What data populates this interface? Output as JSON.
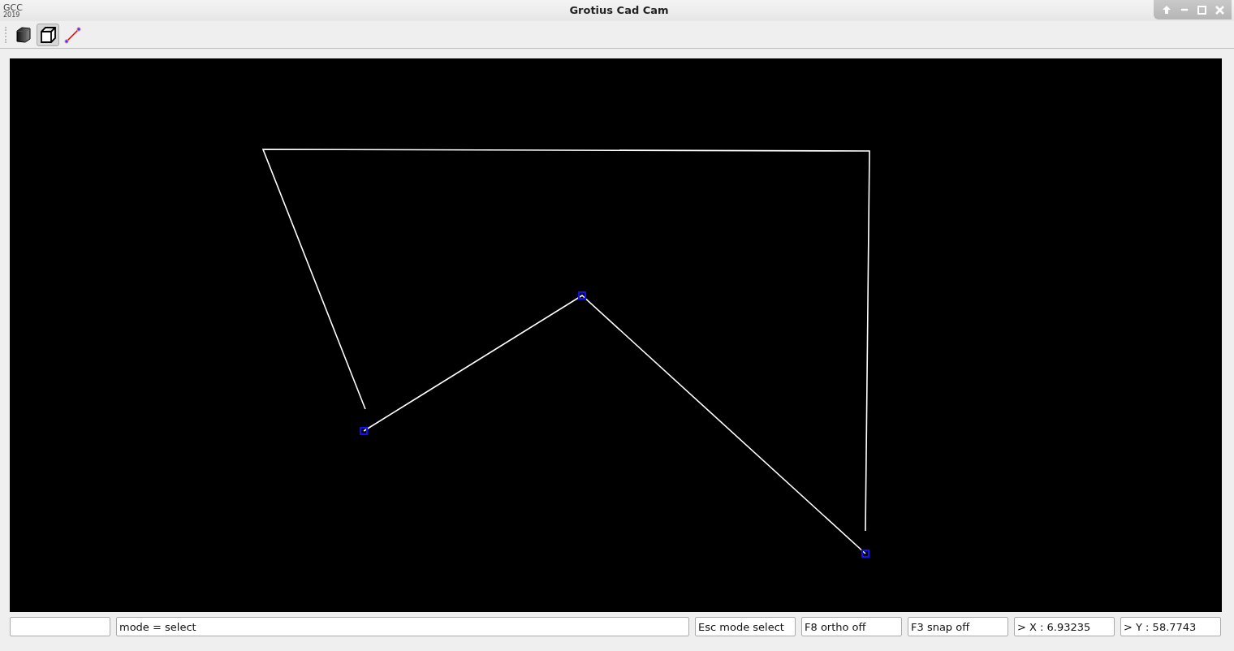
{
  "window": {
    "title": "Grotius Cad Cam",
    "logo": {
      "name": "GCC",
      "year": "2019"
    }
  },
  "toolbar": [
    {
      "kind": "solid-cube",
      "selected": false
    },
    {
      "kind": "wireframe-cube",
      "selected": true
    },
    {
      "kind": "line",
      "selected": false
    }
  ],
  "status_fields": [
    {
      "kind": "blank"
    },
    {
      "kind": "text",
      "value": "mode = select"
    },
    {
      "kind": "text",
      "value": "Esc mode select"
    },
    {
      "kind": "text",
      "value": "F8 ortho off"
    },
    {
      "kind": "text",
      "value": "F3 snap off"
    },
    {
      "kind": "text",
      "value": "> X : 6.93235"
    },
    {
      "kind": "text",
      "value": "> Y : 58.7743"
    }
  ]
}
